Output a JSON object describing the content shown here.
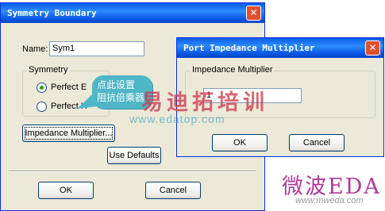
{
  "symmetry_dialog": {
    "title": "Symmetry Boundary",
    "name_label": "Name:",
    "name_value": "Sym1",
    "symmetry_group_label": "Symmetry",
    "radio_perfect_e": "Perfect E",
    "radio_perfect_h": "Perfect H",
    "selected": "Perfect E",
    "impedance_button": "Impedance Multiplier...",
    "use_defaults_button": "Use Defaults",
    "ok_button": "OK",
    "cancel_button": "Cancel"
  },
  "port_dialog": {
    "title": "Port Impedance Multiplier",
    "group_label": "Impedance Multiplier",
    "value": "1",
    "ok_button": "OK",
    "cancel_button": "Cancel"
  },
  "annotation": {
    "line1": "点此设置",
    "line2": "阻抗倍乘器",
    "color": "#4fb6c8"
  },
  "watermarks": {
    "center_text": "易迪拓培训",
    "center_url": "www.edatop.com",
    "corner_text": "微波EDA",
    "corner_url": "www.mweda.com"
  },
  "icons": {
    "close": "close-icon"
  }
}
